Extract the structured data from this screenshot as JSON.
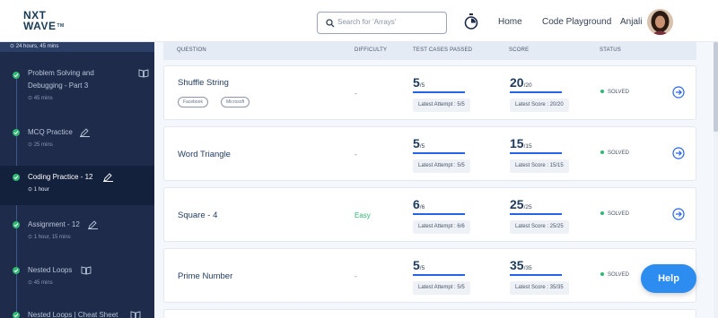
{
  "header": {
    "logo_line1": "NXT",
    "logo_line2": "WAVE",
    "logo_tm": "TM",
    "search_placeholder": "Search for 'Arrays'",
    "nav_home": "Home",
    "nav_code": "Code Playground",
    "user_name": "Anjali"
  },
  "sidebar": {
    "top_text": "24 hours, 45 mins",
    "items": [
      {
        "title_1": "Problem Solving and",
        "title_2": "Debugging - Part 3",
        "duration": "45 mins",
        "icon": "book-icon"
      },
      {
        "title_1": "MCQ Practice",
        "duration": "25 mins",
        "icon": "pencil-icon"
      },
      {
        "title_1": "Coding Practice - 12",
        "duration": "1 hour",
        "icon": "pencil-icon"
      },
      {
        "title_1": "Assignment - 12",
        "duration": "1 hour, 15 mins",
        "icon": "pencil-icon"
      },
      {
        "title_1": "Nested Loops",
        "duration": "45 mins",
        "icon": "book-icon"
      },
      {
        "title_1": "Nested Loops | Cheat Sheet",
        "icon": "book-icon"
      }
    ]
  },
  "table": {
    "headers": {
      "question": "QUESTION",
      "difficulty": "DIFFICULTY",
      "tests": "TEST CASES PASSED",
      "score": "SCORE",
      "status": "STATUS"
    },
    "rows": [
      {
        "question": "Shuffle String",
        "tags": [
          "Facebook",
          "Microsoft"
        ],
        "difficulty": "-",
        "tests_num": "5",
        "tests_den": "/5",
        "attempt": "Latest Attempt : 5/5",
        "score_num": "20",
        "score_den": "/20",
        "score_text": "Latest Score : 20/20",
        "status": "SOLVED"
      },
      {
        "question": "Word Triangle",
        "difficulty": "-",
        "tests_num": "5",
        "tests_den": "/5",
        "attempt": "Latest Attempt : 5/5",
        "score_num": "15",
        "score_den": "/15",
        "score_text": "Latest Score : 15/15",
        "status": "SOLVED"
      },
      {
        "question": "Square - 4",
        "difficulty": "Easy",
        "tests_num": "6",
        "tests_den": "/6",
        "attempt": "Latest Attempt : 6/6",
        "score_num": "25",
        "score_den": "/25",
        "score_text": "Latest Score : 25/25",
        "status": "SOLVED"
      },
      {
        "question": "Prime Number",
        "difficulty": "-",
        "tests_num": "5",
        "tests_den": "/5",
        "attempt": "Latest Attempt : 5/5",
        "score_num": "35",
        "score_den": "/35",
        "score_text": "Latest Score : 35/35",
        "status": "SOLVED"
      }
    ]
  },
  "help_label": "Help",
  "colors": {
    "accent": "#2563eb",
    "solved": "#2eb872",
    "sidebar": "#1e2b4b",
    "help": "#2d8cf0"
  }
}
